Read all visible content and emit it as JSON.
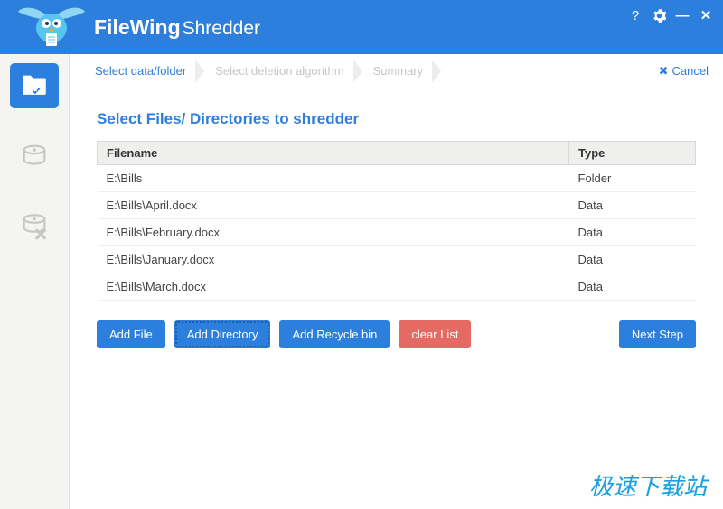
{
  "app": {
    "name_bold": "FileWing",
    "name_thin": "Shredder"
  },
  "breadcrumb": {
    "steps": [
      "Select data/folder",
      "Select deletion algorithm",
      "Summary"
    ],
    "cancel": "Cancel"
  },
  "panel": {
    "title": "Select Files/ Directories to shredder",
    "columns": {
      "filename": "Filename",
      "type": "Type"
    },
    "rows": [
      {
        "name": "E:\\Bills",
        "type": "Folder"
      },
      {
        "name": "E:\\Bills\\April.docx",
        "type": "Data"
      },
      {
        "name": "E:\\Bills\\February.docx",
        "type": "Data"
      },
      {
        "name": "E:\\Bills\\January.docx",
        "type": "Data"
      },
      {
        "name": "E:\\Bills\\March.docx",
        "type": "Data"
      }
    ]
  },
  "buttons": {
    "add_file": "Add File",
    "add_directory": "Add Directory",
    "add_recycle": "Add Recycle bin",
    "clear_list": "clear List",
    "next_step": "Next Step"
  },
  "watermark": "极速下载站"
}
